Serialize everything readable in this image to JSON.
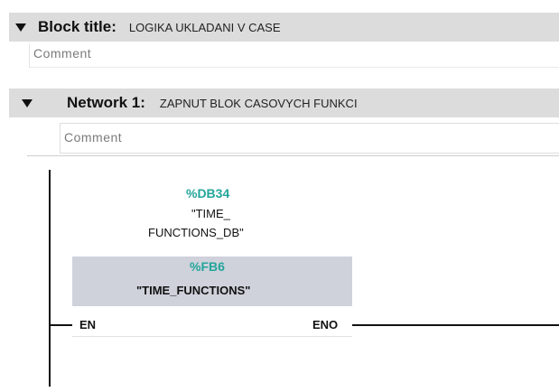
{
  "block": {
    "label": "Block title:",
    "value": "LOGIKA UKLADANI V CASE",
    "comment_placeholder": "Comment"
  },
  "network": {
    "label": "Network 1:",
    "value": "ZAPNUT BLOK CASOVYCH FUNKCI",
    "comment_placeholder": "Comment"
  },
  "instance_db": {
    "address": "%DB34",
    "name_line1": "\"TIME_",
    "name_line2": "FUNCTIONS_DB\""
  },
  "function_block": {
    "address": "%FB6",
    "name": "\"TIME_FUNCTIONS\"",
    "input_pin": "EN",
    "output_pin": "ENO"
  },
  "colors": {
    "header_bg": "#dcdcdc",
    "block_header_bg": "#cfd2db",
    "address_color": "#23a59b"
  }
}
